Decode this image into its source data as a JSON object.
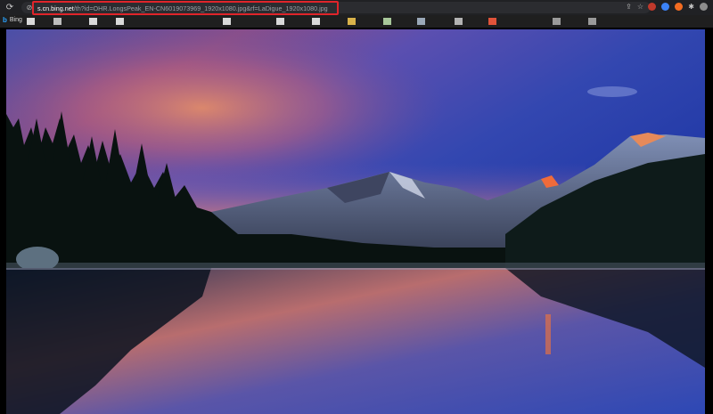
{
  "browser": {
    "url": {
      "domain": "s.cn.bing.net",
      "path": "/th?id=OHR.LongsPeak_EN-CN6019073969_1920x1080.jpg&rf=LaDigue_1920x1080.jpg"
    }
  },
  "bookmarks": {
    "items": [
      {
        "label": "Bing"
      }
    ]
  },
  "image": {
    "subject": "mountain-lake-sunset"
  },
  "colors": {
    "url_highlight": "#e0242a",
    "toolbar": "#202124",
    "bookmarks_bar": "#1f1f1f"
  }
}
